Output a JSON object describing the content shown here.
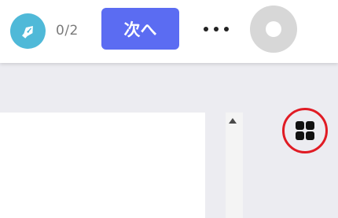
{
  "toolbar": {
    "signature_icon": "fountain-pen-icon",
    "signature_counter": "0/2",
    "next_label": "次へ",
    "more_icon": "more-horizontal-icon",
    "avatar_icon": "user-avatar"
  },
  "sidebar": {
    "view_toggle_icon": "grid-view-icon",
    "highlight_color": "#e01b24"
  },
  "colors": {
    "accent": "#5b6cf2",
    "signature_badge": "#4fb9d8",
    "background": "#ececf1"
  }
}
